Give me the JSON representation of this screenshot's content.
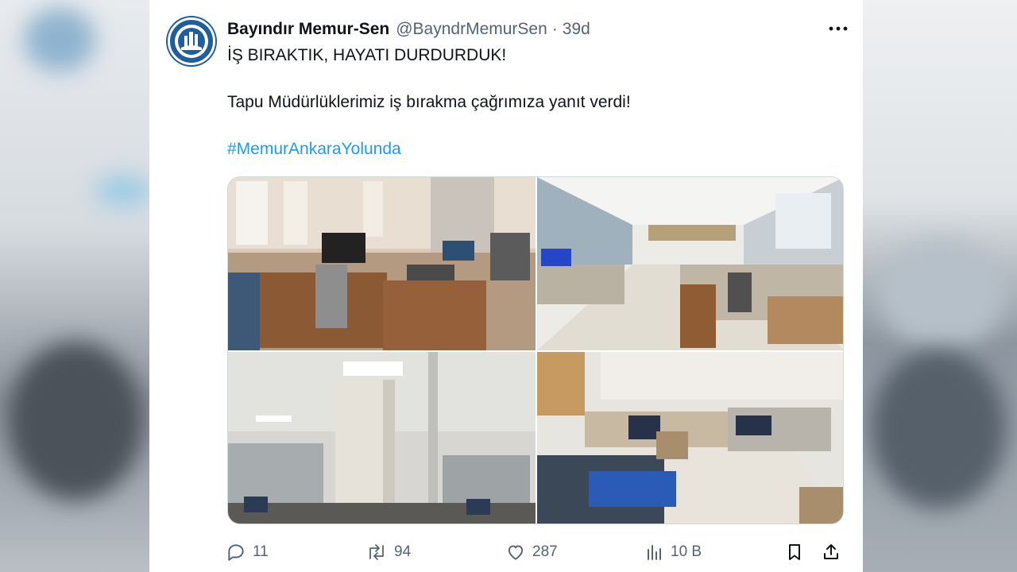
{
  "tweet": {
    "author_name": "Bayındır Memur-Sen",
    "author_handle": "@BayndrMemurSen",
    "separator": "·",
    "time": "39d",
    "line1": "İŞ BIRAKTIK, HAYATI DURDURDUK!",
    "line2": "Tapu Müdürlüklerimiz iş bırakma çağrımıza yanıt verdi!",
    "hashtag": "#MemurAnkaraYolunda"
  },
  "media": {
    "photos": [
      {
        "icon": "office-photo-1"
      },
      {
        "icon": "office-photo-2"
      },
      {
        "icon": "office-photo-3"
      },
      {
        "icon": "office-photo-4"
      }
    ]
  },
  "actions": {
    "replies": "11",
    "reposts": "94",
    "likes": "287",
    "views": "10 B"
  },
  "colors": {
    "accent": "#1d9bf0",
    "text": "#0f1419",
    "muted": "#536471",
    "avatar": "#1f5e9c"
  }
}
